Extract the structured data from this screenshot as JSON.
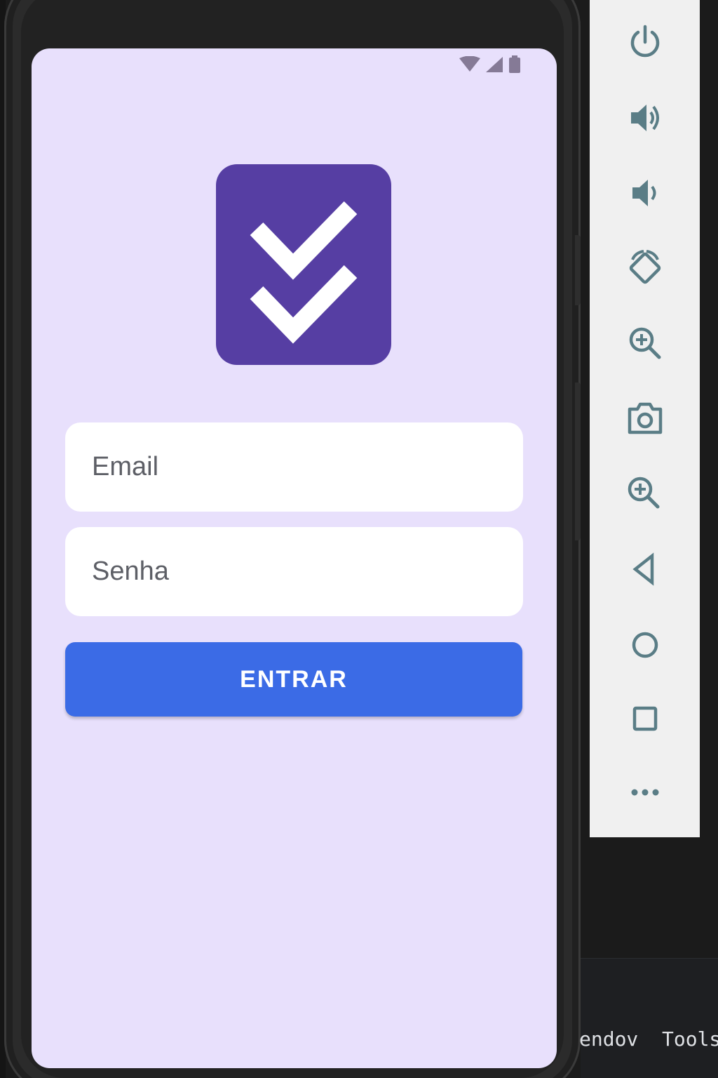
{
  "status_bar": {
    "icons": [
      "wifi-icon",
      "cellular-signal-icon",
      "battery-icon"
    ]
  },
  "app": {
    "logo_icon": "double-check-icon",
    "logo_color": "#563ea3",
    "screen_background": "#e8e0fc",
    "email_placeholder": "Email",
    "password_placeholder": "Senha",
    "login_button_label": "ENTRAR",
    "button_color": "#3b6be6"
  },
  "emulator_toolbar": {
    "items": [
      {
        "name": "power-button",
        "icon": "power-icon"
      },
      {
        "name": "volume-up-button",
        "icon": "volume-up-icon"
      },
      {
        "name": "volume-down-button",
        "icon": "volume-down-icon"
      },
      {
        "name": "rotate-button",
        "icon": "rotate-icon"
      },
      {
        "name": "zoom-in-button",
        "icon": "zoom-in-icon"
      },
      {
        "name": "screenshot-button",
        "icon": "camera-icon"
      },
      {
        "name": "zoom-button",
        "icon": "zoom-in-icon"
      },
      {
        "name": "back-button",
        "icon": "back-triangle-icon"
      },
      {
        "name": "home-button",
        "icon": "home-circle-icon"
      },
      {
        "name": "overview-button",
        "icon": "overview-square-icon"
      },
      {
        "name": "more-button",
        "icon": "more-dots-icon"
      }
    ]
  },
  "ide": {
    "bottom_text": "endov  Tools"
  }
}
